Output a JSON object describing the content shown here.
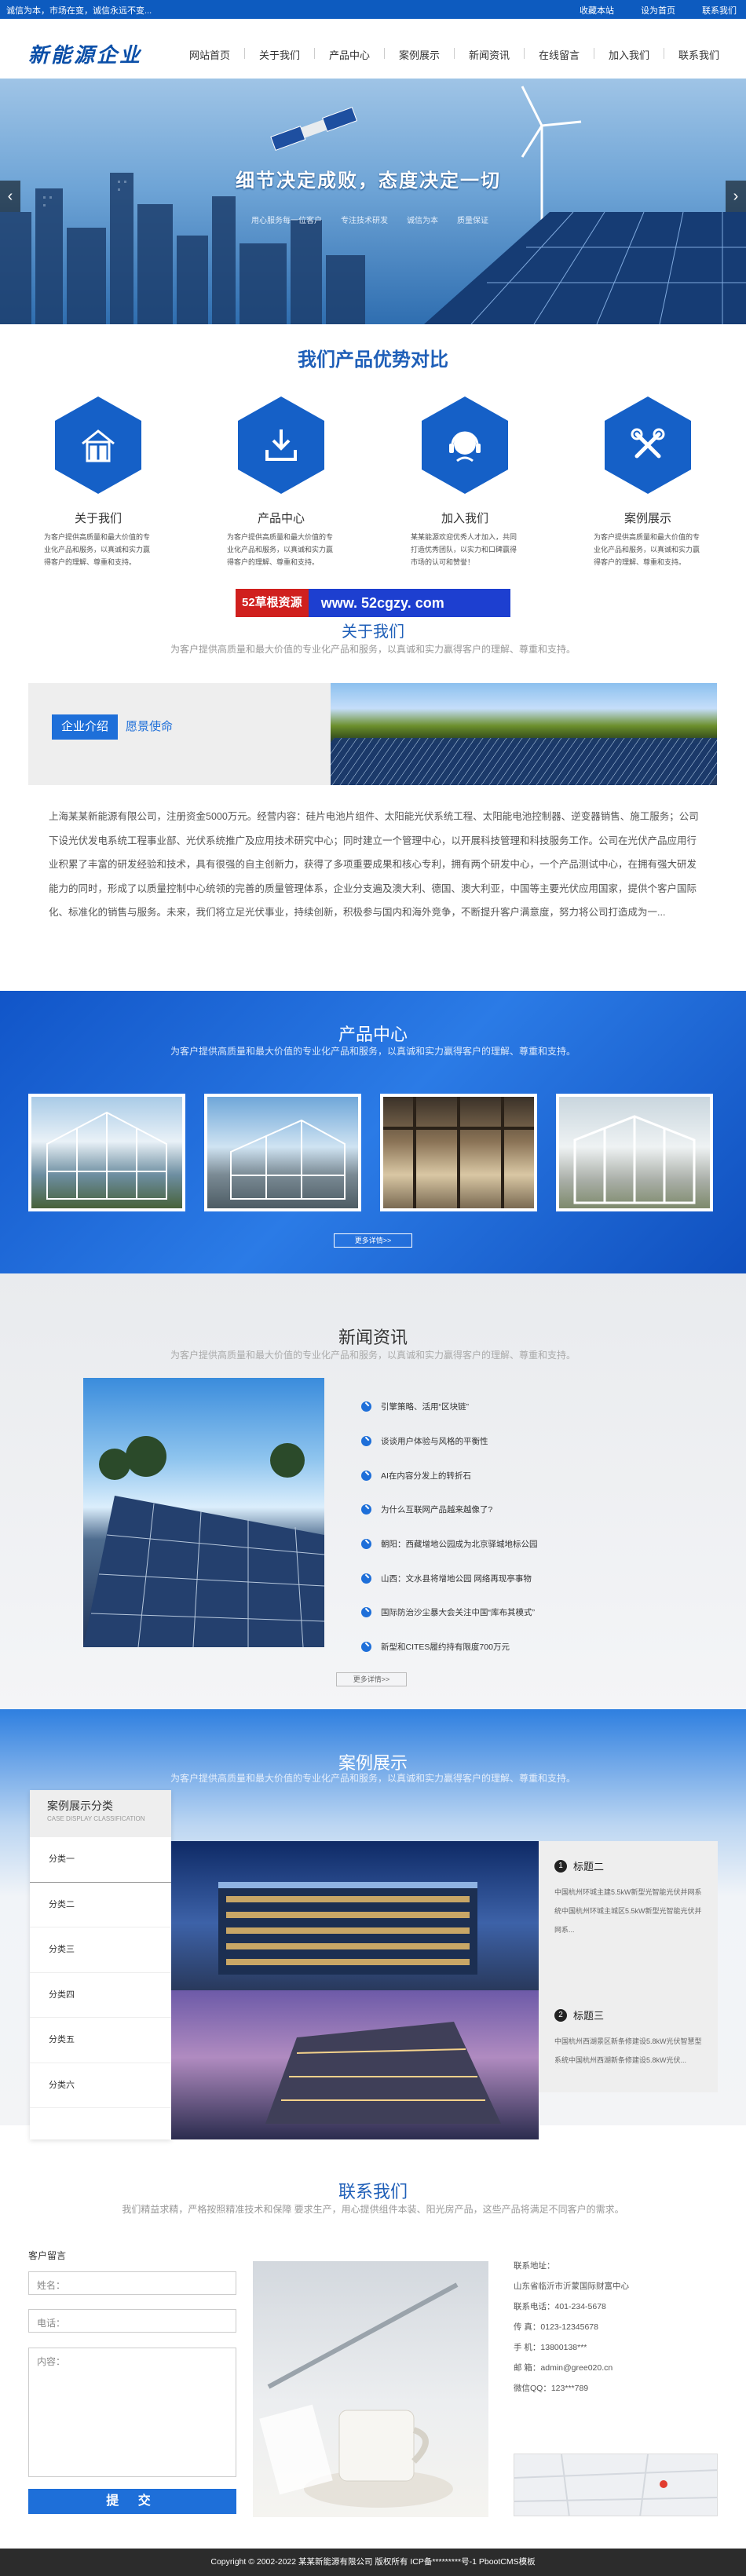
{
  "topbar": {
    "slogan": "诚信为本，市场在变，诚信永远不变...",
    "links": [
      "收藏本站",
      "设为首页",
      "联系我们"
    ]
  },
  "header": {
    "logo": "新能源企业",
    "nav": [
      "网站首页",
      "关于我们",
      "产品中心",
      "案例展示",
      "新闻资讯",
      "在线留言",
      "加入我们",
      "联系我们"
    ]
  },
  "banner": {
    "title": "细节决定成败，态度决定一切",
    "subs": [
      "用心服务每一位客户",
      "专注技术研发",
      "诚信为本",
      "质量保证"
    ],
    "prev": "‹",
    "next": "›"
  },
  "advantages": {
    "title": "我们产品优势对比",
    "items": [
      {
        "icon": "house-icon",
        "title": "关于我们",
        "desc": "为客户提供高质量和最大价值的专业化产品和服务，以真诚和实力赢得客户的理解、尊重和支持。"
      },
      {
        "icon": "download-icon",
        "title": "产品中心",
        "desc": "为客户提供高质量和最大价值的专业化产品和服务，以真诚和实力赢得客户的理解、尊重和支持。"
      },
      {
        "icon": "headset-icon",
        "title": "加入我们",
        "desc": "某某能源欢迎优秀人才加入，共同打造优秀团队，以实力和口碑赢得市场的认可和赞誉！"
      },
      {
        "icon": "tools-icon",
        "title": "案例展示",
        "desc": "为客户提供高质量和最大价值的专业化产品和服务，以真诚和实力赢得客户的理解、尊重和支持。"
      }
    ]
  },
  "watermark": {
    "brand": "52草根资源",
    "url": "www. 52cgzy. com"
  },
  "about": {
    "title": "关于我们",
    "subtitle": "为客户提供高质量和最大价值的专业化产品和服务，以真诚和实力赢得客户的理解、尊重和支持。",
    "tab_active": "企业介绍",
    "tab_other": "愿景使命",
    "text": "上海某某新能源有限公司，注册资金5000万元。经营内容：硅片电池片组件、太阳能光伏系统工程、太阳能电池控制器、逆变器销售、施工服务；公司下设光伏发电系统工程事业部、光伏系统推广及应用技术研究中心；同时建立一个管理中心，以开展科技管理和科技服务工作。公司在光伏产品应用行业积累了丰富的研发经验和技术，具有很强的自主创新力，获得了多项重要成果和核心专利，拥有两个研发中心，一个产品测试中心，在拥有强大研发能力的同时，形成了以质量控制中心统领的完善的质量管理体系，企业分支遍及澳大利、德国、澳大利亚，中国等主要光伏应用国家，提供个客户国际化、标准化的销售与服务。未来，我们将立足光伏事业，持续创新，积极参与国内和海外竞争，不断提升客户满意度，努力将公司打造成为一..."
  },
  "products": {
    "title": "产品中心",
    "subtitle": "为客户提供高质量和最大价值的专业化产品和服务，以真诚和实力赢得客户的理解、尊重和支持。",
    "more": "更多详情>>"
  },
  "news": {
    "title": "新闻资讯",
    "subtitle": "为客户提供高质量和最大价值的专业化产品和服务，以真诚和实力赢得客户的理解、尊重和支持。",
    "more": "更多详情>>",
    "items": [
      "引擎策略、活用“区块链”",
      "谈谈用户体验与风格的平衡性",
      "AI在内容分发上的转折石",
      "为什么互联网产品越来越像了?",
      "朝阳：西藏增地公园成为北京驿城地标公园",
      "山西：文水县将增地公园 网络再现亭事物",
      "国际防治沙尘暴大会关注中国“库布其模式”",
      "新型和CITES履约持有限度700万元"
    ]
  },
  "cases": {
    "title": "案例展示",
    "subtitle": "为客户提供高质量和最大价值的专业化产品和服务，以真诚和实力赢得客户的理解、尊重和支持。",
    "cat_title": "案例展示分类",
    "cat_en": "CASE DISPLAY CLASSIFICATION",
    "categories": [
      "分类一",
      "分类二",
      "分类三",
      "分类四",
      "分类五",
      "分类六"
    ],
    "items": [
      {
        "num": "1",
        "title": "标题二",
        "desc": "中国杭州环城主建5.5kW新型光智能光伏并网系统中国杭州环城主城区5.5kW新型光智能光伏并网系..."
      },
      {
        "num": "2",
        "title": "标题三",
        "desc": "中国杭州西湖景区新条修建设5.8kW光伏智慧型系统中国杭州西湖新条修建设5.8kW光伏..."
      }
    ]
  },
  "contact": {
    "title": "联系我们",
    "subtitle": "我们精益求精，严格按照精准技术和保障 要求生产，用心提供组件本装、阳光房产品，这些产品将满足不同客户的需求。",
    "form_title": "客户留言",
    "name_ph": "姓名：",
    "phone_ph": "电话：",
    "content_ph": "内容：",
    "submit": "提 交",
    "info": [
      "联系地址：",
      "山东省临沂市沂蒙国际财富中心",
      "联系电话：401-234-5678",
      "传 真：0123-12345678",
      "手 机：13800138***",
      "邮 箱：admin@gree020.cn",
      "微信QQ：123***789"
    ]
  },
  "footer": {
    "text": "Copyright © 2002-2022 某某新能源有限公司 版权所有  ICP备*********号-1  PbootCMS模板"
  },
  "colors": {
    "primary": "#1e6fd9",
    "topbar": "#0d5bbf",
    "title_blue": "#1f5fb8",
    "footer": "#2c2c2c"
  }
}
